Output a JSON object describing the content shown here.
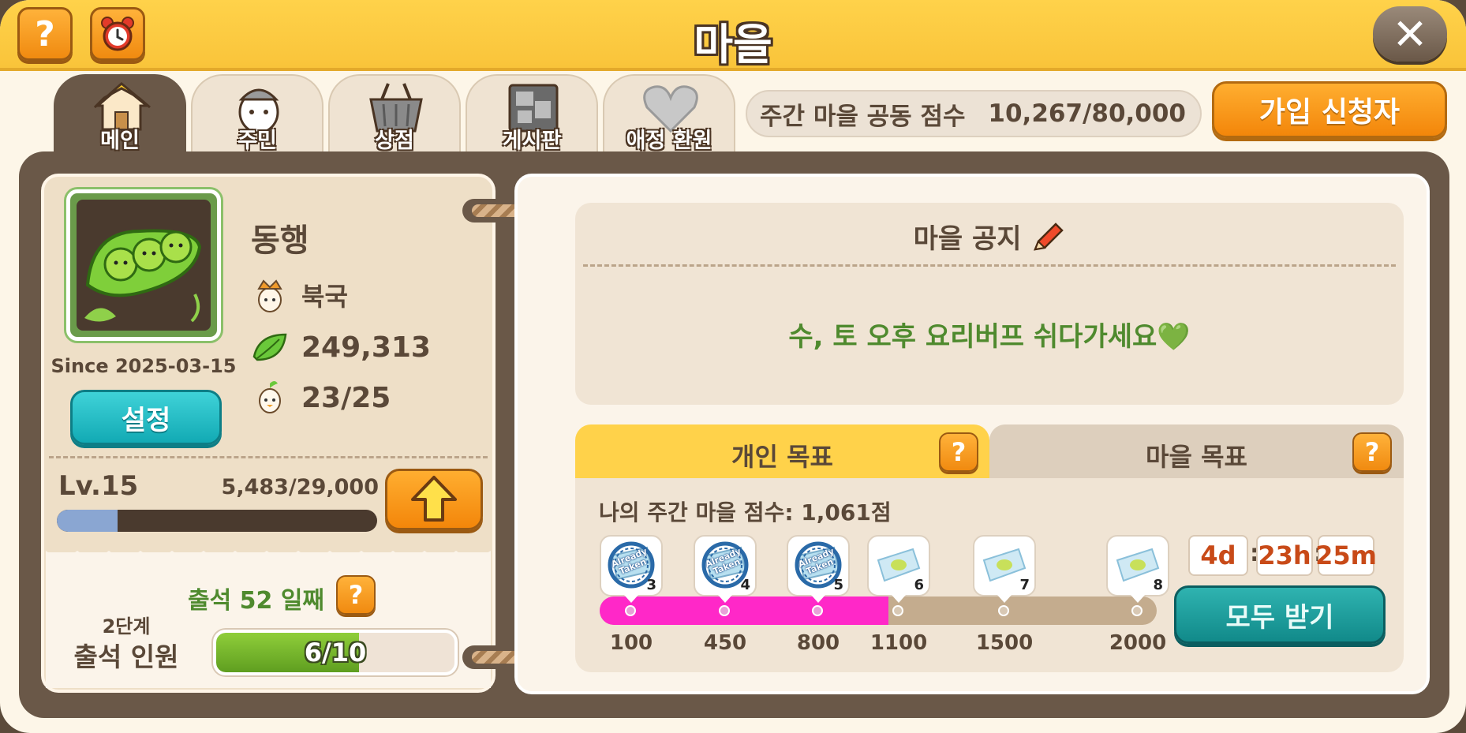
{
  "window": {
    "title": "마을",
    "help_label": "?",
    "close_label": "✕",
    "icons": {
      "help": "question-icon",
      "alarm": "alarm-clock-icon",
      "close": "close-icon"
    }
  },
  "tabs": [
    {
      "label": "메인",
      "icon": "house-icon",
      "active": true
    },
    {
      "label": "주민",
      "icon": "resident-icon",
      "active": false
    },
    {
      "label": "상점",
      "icon": "basket-icon",
      "active": false
    },
    {
      "label": "게시판",
      "icon": "board-icon",
      "active": false
    },
    {
      "label": "애정 환원",
      "icon": "heart-icon",
      "active": false
    }
  ],
  "weekly_score": {
    "label": "주간 마을 공동 점수",
    "value": "10,267/80,000"
  },
  "applicants_button": "가입 신청자",
  "village": {
    "emblem_icon": "pea-pod-icon",
    "name": "동행",
    "since": "Since 2025-03-15",
    "settings_label": "설정",
    "region": "북국",
    "leaves": "249,313",
    "members": "23/25",
    "level": "Lv.15",
    "xp": "5,483/29,000",
    "xp_progress": 0.189,
    "upgrade_icon": "arrow-up-icon"
  },
  "attendance": {
    "title": "출석 52 일째",
    "help_label": "?",
    "stage": "2단계",
    "label": "출석 인원",
    "value": "6/10",
    "progress": 0.6
  },
  "notice": {
    "title": "마을 공지",
    "title_icon": "pencil-icon",
    "text": "수, 토 오후 요리버프 쉬다가세요💚"
  },
  "goals": {
    "tab_personal": "개인 목표",
    "tab_village": "마을 목표",
    "help_label": "?",
    "my_score": "나의 주간 마을 점수: 1,061점",
    "score_value": 1061,
    "milestones": [
      {
        "value": "100",
        "reward_num": "3",
        "claimed": true,
        "stamp": "Already Taken"
      },
      {
        "value": "450",
        "reward_num": "4",
        "claimed": true,
        "stamp": "Already Taken"
      },
      {
        "value": "800",
        "reward_num": "5",
        "claimed": true,
        "stamp": "Already Taken"
      },
      {
        "value": "1100",
        "reward_num": "6",
        "claimed": false,
        "stamp": ""
      },
      {
        "value": "1500",
        "reward_num": "7",
        "claimed": false,
        "stamp": ""
      },
      {
        "value": "2000",
        "reward_num": "8",
        "claimed": false,
        "stamp": ""
      }
    ],
    "timer": {
      "days": "4d",
      "hours": "23h",
      "minutes": "25m"
    },
    "claim_all": "모두 받기"
  },
  "colors": {
    "title_bar": "#ffd24a",
    "board": "#6a5848",
    "accent_orange": "#f3860a",
    "accent_teal": "#12aab4",
    "progress_pink": "#ff28c8",
    "notice_green": "#4f8a2e"
  }
}
